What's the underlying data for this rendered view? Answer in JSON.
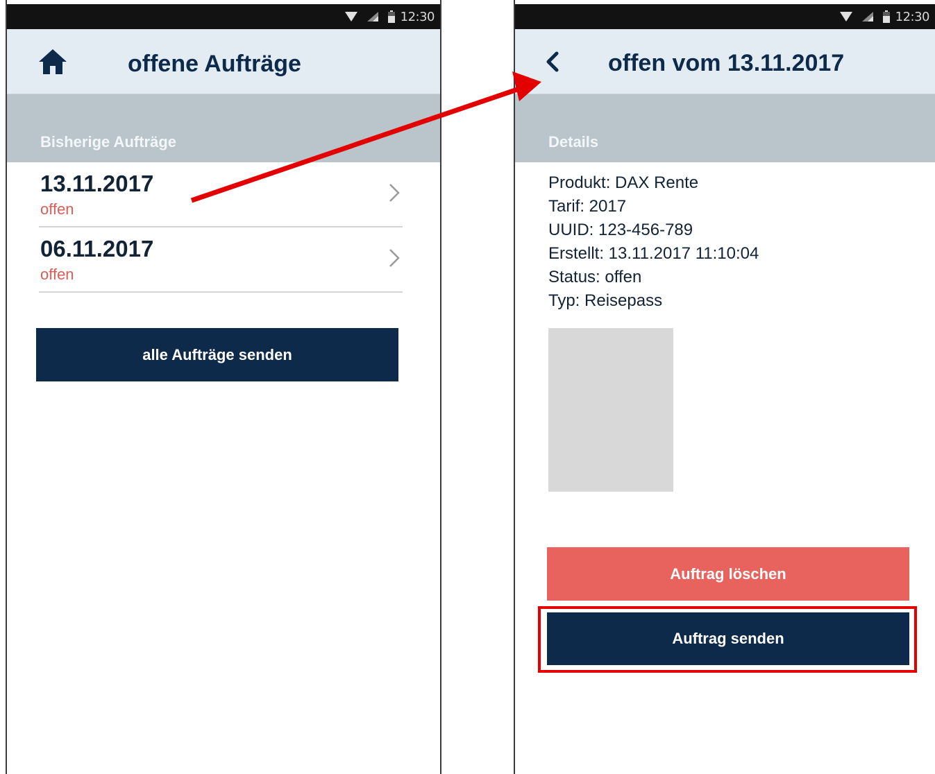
{
  "left_screen": {
    "statusbar": {
      "time": "12:30"
    },
    "appbar": {
      "title": "offene Aufträge",
      "nav_icon": "home-icon"
    },
    "section_header": "Bisherige Aufträge",
    "orders": [
      {
        "date": "13.11.2017",
        "status": "offen"
      },
      {
        "date": "06.11.2017",
        "status": "offen"
      }
    ],
    "send_all_button": "alle Aufträge senden"
  },
  "right_screen": {
    "statusbar": {
      "time": "12:30"
    },
    "appbar": {
      "title": "offen vom 13.11.2017",
      "nav_icon": "back-chevron-icon"
    },
    "section_header": "Details",
    "details": {
      "produkt": "Produkt: DAX Rente",
      "tarif": "Tarif: 2017",
      "uuid": "UUID: 123-456-789",
      "erstellt": "Erstellt: 13.11.2017 11:10:04",
      "status": "Status: offen",
      "typ": "Typ: Reisepass"
    },
    "delete_button": "Auftrag löschen",
    "send_button": "Auftrag senden"
  },
  "colors": {
    "navy": "#0e2a4b",
    "appbar_bg": "#e3ecf3",
    "section_bg": "#b9c4cb",
    "status_red": "#dc5d57",
    "delete_red": "#e8635d",
    "annotation_red": "#e30000"
  }
}
